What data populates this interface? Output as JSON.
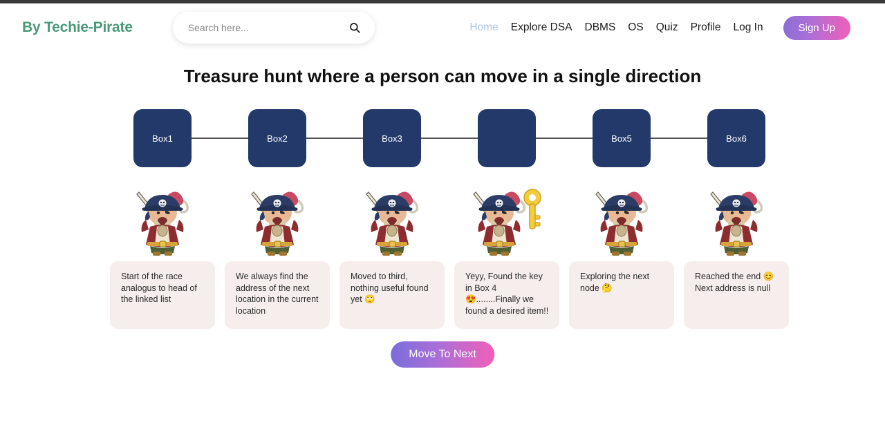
{
  "header": {
    "brand": "By Techie-Pirate",
    "search": {
      "placeholder": "Search here...",
      "value": "",
      "icon": "search-icon"
    },
    "nav": [
      {
        "label": "Home",
        "active": true
      },
      {
        "label": "Explore DSA",
        "active": false
      },
      {
        "label": "DBMS",
        "active": false
      },
      {
        "label": "OS",
        "active": false
      },
      {
        "label": "Quiz",
        "active": false
      },
      {
        "label": "Profile",
        "active": false
      },
      {
        "label": "Log In",
        "active": false
      }
    ],
    "signup_label": "Sign Up"
  },
  "page_title": "Treasure hunt where a person can move in a single direction",
  "nodes": [
    {
      "label": "Box1",
      "has_key": false,
      "note": "Start of the race analogus to head of the linked list"
    },
    {
      "label": "Box2",
      "has_key": false,
      "note": "We always find the address of the next location in the current location"
    },
    {
      "label": "Box3",
      "has_key": false,
      "note": "Moved to third, nothing useful found yet 🙄"
    },
    {
      "label": "",
      "has_key": true,
      "note": "Yeyy, Found the key in Box 4 😍........Finally we found a desired item!!"
    },
    {
      "label": "Box5",
      "has_key": false,
      "note": "Exploring the next node 🤔"
    },
    {
      "label": "Box6",
      "has_key": false,
      "note": "Reached the end 😊 Next address is null"
    }
  ],
  "move_button_label": "Move To Next",
  "colors": {
    "brand_green": "#4a9a78",
    "node_navy": "#22396a",
    "card_bg": "#f6eeec",
    "gradient_start": "#7a6ddb",
    "gradient_end": "#f060b8",
    "active_nav": "#a9c8e8",
    "connector": "#555555"
  }
}
